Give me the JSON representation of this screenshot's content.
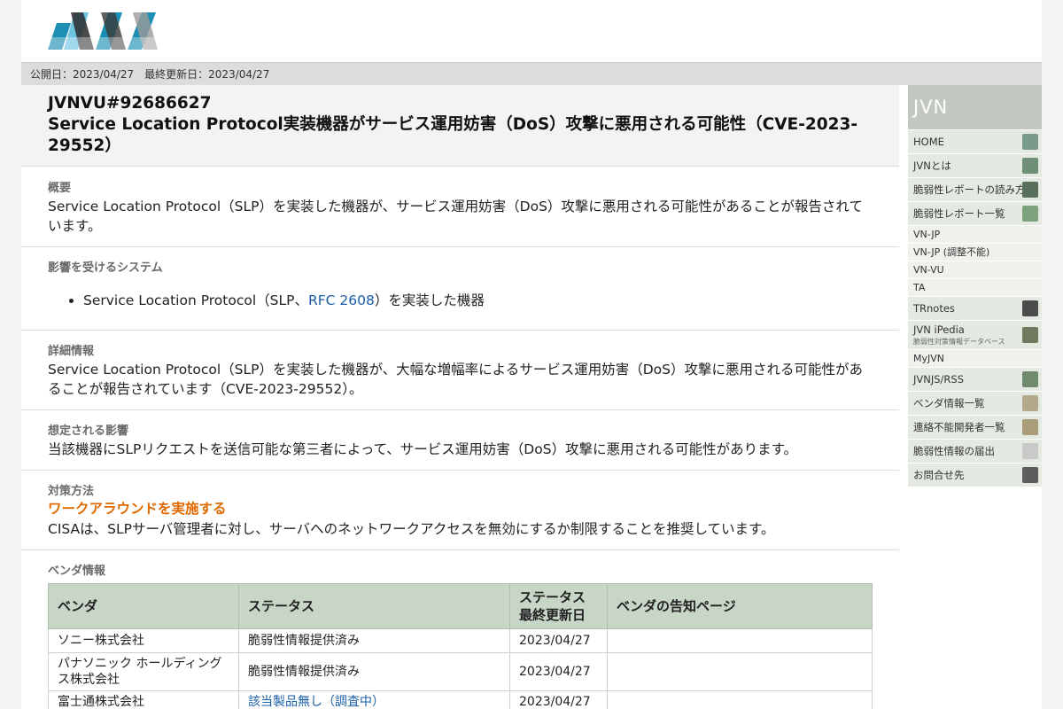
{
  "header": {
    "logo_alt": "JVN"
  },
  "dates": "公開日：2023/04/27　最終更新日：2023/04/27",
  "title": {
    "id": "JVNVU#92686627",
    "text": "Service Location Protocol実装機器がサービス運用妨害（DoS）攻撃に悪用される可能性（CVE-2023-29552）"
  },
  "overview": {
    "heading": "概要",
    "text": "Service Location Protocol（SLP）を実装した機器が、サービス運用妨害（DoS）攻撃に悪用される可能性があることが報告されています。"
  },
  "affected": {
    "heading": "影響を受けるシステム",
    "item_prefix": "Service Location Protocol（SLP、",
    "item_link": "RFC 2608",
    "item_suffix": "）を実装した機器"
  },
  "details": {
    "heading": "詳細情報",
    "text": "Service Location Protocol（SLP）を実装した機器が、大幅な増幅率によるサービス運用妨害（DoS）攻撃に悪用される可能性があることが報告されています（CVE-2023-29552）。"
  },
  "impact": {
    "heading": "想定される影響",
    "text": "当該機器にSLPリクエストを送信可能な第三者によって、サービス運用妨害（DoS）攻撃に悪用される可能性があります。"
  },
  "solution": {
    "heading": "対策方法",
    "subheading": "ワークアラウンドを実施する",
    "text": "CISAは、SLPサーバ管理者に対し、サーバへのネットワークアクセスを無効にするか制限することを推奨しています。"
  },
  "vendors": {
    "heading": "ベンダ情報",
    "columns": [
      "ベンダ",
      "ステータス",
      "ステータス\n最終更新日",
      "ベンダの告知ページ"
    ],
    "rows": [
      {
        "vendor": "ソニー株式会社",
        "status": "脆弱性情報提供済み",
        "date": "2023/04/27",
        "page": ""
      },
      {
        "vendor": "パナソニック ホールディングス株式会社",
        "status": "脆弱性情報提供済み",
        "date": "2023/04/27",
        "page": ""
      },
      {
        "vendor": "富士通株式会社",
        "status": "該当製品無し（調査中）",
        "date": "2023/04/27",
        "page": ""
      }
    ]
  },
  "sidebar": {
    "title": "JVN",
    "items": [
      {
        "label": "HOME",
        "icon": "building-icon",
        "color": "#7a9a8a",
        "size": "big"
      },
      {
        "label": "JVNとは",
        "icon": "globe-icon",
        "color": "#6f8f77",
        "size": "big"
      },
      {
        "label": "脆弱性レポートの読み方",
        "icon": "eye-icon",
        "color": "#58705c",
        "size": "big"
      },
      {
        "label": "脆弱性レポート一覧",
        "icon": "list-icon",
        "color": "#7ea27c",
        "size": "big"
      },
      {
        "label": "VN-JP",
        "size": "small"
      },
      {
        "label": "VN-JP (調整不能)",
        "size": "small"
      },
      {
        "label": "VN-VU",
        "size": "small"
      },
      {
        "label": "TA",
        "size": "small"
      },
      {
        "label": "TRnotes",
        "icon": "pin-icon",
        "color": "#4b4b4b",
        "size": "big"
      },
      {
        "label": "JVN iPedia",
        "sub": "脆弱性対策情報データベース",
        "icon": "pattern-icon",
        "color": "#6f7a5f",
        "size": "ipedia"
      },
      {
        "label": "MyJVN",
        "size": "small"
      },
      {
        "label": "JVNJS/RSS",
        "icon": "globe-icon",
        "color": "#708a6e",
        "size": "big"
      },
      {
        "label": "ベンダ情報一覧",
        "icon": "vendor-icon",
        "color": "#b3a98a",
        "size": "big"
      },
      {
        "label": "連絡不能開発者一覧",
        "icon": "vendor-icon",
        "color": "#a99d7a",
        "size": "big"
      },
      {
        "label": "脆弱性情報の届出",
        "icon": "mail-icon",
        "color": "#c9c9c9",
        "size": "big"
      },
      {
        "label": "お問合せ先",
        "icon": "contact-icon",
        "color": "#5c5c5c",
        "size": "big"
      }
    ]
  }
}
